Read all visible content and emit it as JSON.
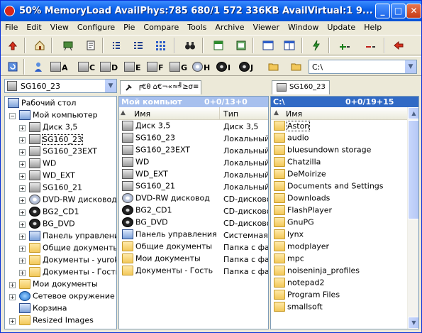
{
  "window": {
    "title": "50% MemoryLoad  AvailPhys:785 680/1 572 336KB AvailVirtual:1 9...",
    "minimize": "_",
    "maximize": "□",
    "close": "✕"
  },
  "menu": [
    "File",
    "Edit",
    "View",
    "Configure",
    "Pie",
    "Compare",
    "Tools",
    "Archive",
    "Viewer",
    "Window",
    "Update",
    "Help"
  ],
  "drives": [
    {
      "letter": "A",
      "icon": "floppy-icon"
    },
    {
      "letter": "C",
      "icon": "drive-icon"
    },
    {
      "letter": "D",
      "icon": "drive-icon"
    },
    {
      "letter": "E",
      "icon": "drive-icon"
    },
    {
      "letter": "F",
      "icon": "drive-icon"
    },
    {
      "letter": "G",
      "icon": "drive-icon"
    },
    {
      "letter": "H",
      "icon": "cd-icon"
    },
    {
      "letter": "I",
      "icon": "cd-black-icon"
    },
    {
      "letter": "J",
      "icon": "cd-black-icon"
    }
  ],
  "path_combo": "C:\\",
  "left_tree": {
    "combo": "SG160_23",
    "items": [
      {
        "label": "Рабочий стол",
        "icon": "desktop-icon",
        "level": 0,
        "expander": ""
      },
      {
        "label": "Мой компьютер",
        "icon": "computer-icon",
        "level": 1,
        "expander": "−"
      },
      {
        "label": "Диск 3,5",
        "icon": "floppy-icon",
        "level": 2,
        "expander": "+"
      },
      {
        "label": "SG160_23",
        "icon": "drive-icon",
        "level": 2,
        "expander": "+",
        "selected": true
      },
      {
        "label": "SG160_23EXT",
        "icon": "drive-icon",
        "level": 2,
        "expander": "+"
      },
      {
        "label": "WD",
        "icon": "drive-icon",
        "level": 2,
        "expander": "+"
      },
      {
        "label": "WD_EXT",
        "icon": "drive-icon",
        "level": 2,
        "expander": "+"
      },
      {
        "label": "SG160_21",
        "icon": "drive-icon",
        "level": 2,
        "expander": "+"
      },
      {
        "label": "DVD-RW дисковод",
        "icon": "cd-icon",
        "level": 2,
        "expander": "+"
      },
      {
        "label": "BG2_CD1",
        "icon": "cd-black-icon",
        "level": 2,
        "expander": "+"
      },
      {
        "label": "BG_DVD",
        "icon": "cd-black-icon",
        "level": 2,
        "expander": "+"
      },
      {
        "label": "Панель управления",
        "icon": "control-panel-icon",
        "level": 2,
        "expander": "+"
      },
      {
        "label": "Общие документы",
        "icon": "folder-icon",
        "level": 2,
        "expander": "+"
      },
      {
        "label": "Документы - yurok",
        "icon": "folder-icon",
        "level": 2,
        "expander": "+"
      },
      {
        "label": "Документы - Гость",
        "icon": "folder-icon",
        "level": 2,
        "expander": "+"
      },
      {
        "label": "Мои документы",
        "icon": "documents-icon",
        "level": 1,
        "expander": "+"
      },
      {
        "label": "Сетевое окружение",
        "icon": "network-icon",
        "level": 1,
        "expander": "+"
      },
      {
        "label": "Корзина",
        "icon": "recycle-bin-icon",
        "level": 1,
        "expander": ""
      },
      {
        "label": "Resized Images",
        "icon": "folder-icon",
        "level": 1,
        "expander": "+"
      }
    ]
  },
  "middle_panel": {
    "tab": "╒€θ ⌂€¬«≈╝≥σ≡",
    "header_path": "Мой компьют",
    "header_count": "0+0/13+0",
    "col_name": "Имя",
    "col_type": "Тип",
    "rows": [
      {
        "name": "Диск 3,5",
        "type": "Диск 3,5",
        "icon": "floppy-icon"
      },
      {
        "name": "SG160_23",
        "type": "Локальный",
        "icon": "drive-icon"
      },
      {
        "name": "SG160_23EXT",
        "type": "Локальный",
        "icon": "drive-icon"
      },
      {
        "name": "WD",
        "type": "Локальный",
        "icon": "drive-icon"
      },
      {
        "name": "WD_EXT",
        "type": "Локальный",
        "icon": "drive-icon"
      },
      {
        "name": "SG160_21",
        "type": "Локальный",
        "icon": "drive-icon"
      },
      {
        "name": "DVD-RW дисковод",
        "type": "CD-дисковод",
        "icon": "cd-icon"
      },
      {
        "name": "BG2_CD1",
        "type": "CD-дисковод",
        "icon": "cd-black-icon"
      },
      {
        "name": "BG_DVD",
        "type": "CD-дисковод",
        "icon": "cd-black-icon"
      },
      {
        "name": "Панель управления",
        "type": "Системная п",
        "icon": "control-panel-icon"
      },
      {
        "name": "Общие документы",
        "type": "Папка с фай",
        "icon": "folder-icon"
      },
      {
        "name": "Мои документы",
        "type": "Папка с фай",
        "icon": "folder-icon"
      },
      {
        "name": "Документы - Гость",
        "type": "Папка с фай",
        "icon": "folder-icon"
      }
    ]
  },
  "right_panel": {
    "tab": "SG160_23",
    "header_path": "C:\\",
    "header_count": "0+0/19+15",
    "col_name": "Имя",
    "rows": [
      "Aston",
      "audio",
      "bluesundown storage",
      "Chatzilla",
      "DeMoirize",
      "Documents and Settings",
      "Downloads",
      "FlashPlayer",
      "GnuPG",
      "lynx",
      "modplayer",
      "mpc",
      "noiseninja_profiles",
      "notepad2",
      "Program Files",
      "smallsoft"
    ]
  },
  "colors": {
    "panel_header": "#A7C0EE",
    "panel_header_active": "#316AC5",
    "title_gradient": "#0A5FE8"
  }
}
